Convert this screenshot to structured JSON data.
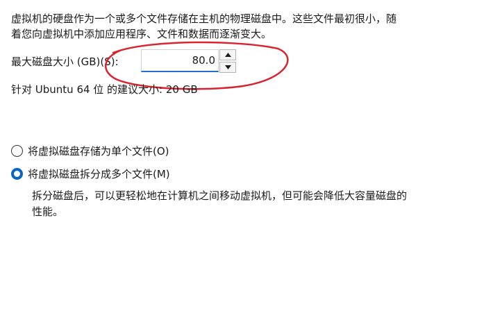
{
  "intro": {
    "line1": "虚拟机的硬盘作为一个或多个文件存储在主机的物理磁盘中。这些文件最初很小，随",
    "line2": "着您向虚拟机中添加应用程序、文件和数据而逐渐变大。"
  },
  "disk_size": {
    "label": "最大磁盘大小 (GB)(S):",
    "value": "80.0"
  },
  "recommendation": "针对 Ubuntu 64 位 的建议大小: 20 GB",
  "storage_options": {
    "single_file": {
      "label": "将虚拟磁盘存储为单个文件(O)",
      "selected": false
    },
    "split_files": {
      "label": "将虚拟磁盘拆分成多个文件(M)",
      "selected": true
    },
    "split_description": {
      "line1": "拆分磁盘后，可以更轻松地在计算机之间移动虚拟机，但可能会降低大容量磁盘的",
      "line2": "性能。"
    }
  },
  "colors": {
    "accent": "#0a64c2",
    "annotation": "#d9232e"
  },
  "icons": {
    "spin_up": "triangle-up-icon",
    "spin_down": "triangle-down-icon"
  }
}
